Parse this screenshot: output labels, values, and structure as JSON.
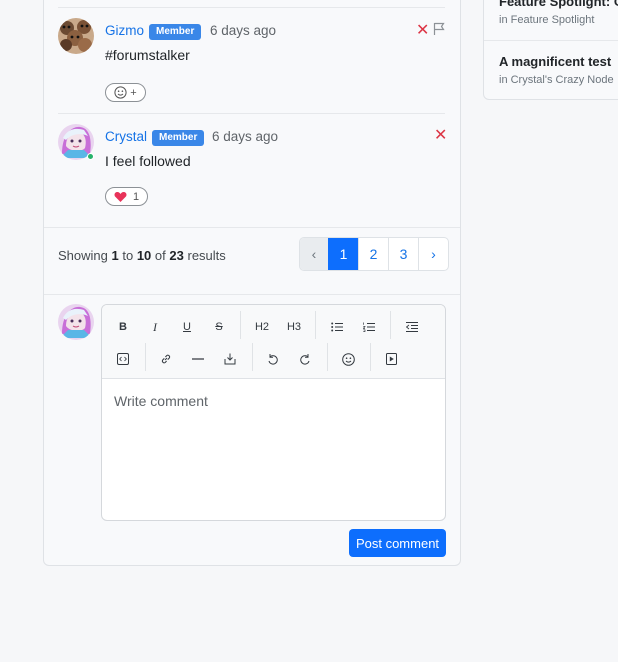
{
  "comments": [
    {
      "user": "Gizmo",
      "role": "Member",
      "time": "6 days ago",
      "text": "#forumstalker",
      "reaction_add_label": "+",
      "avatar": "gizmo-avatar",
      "online": false
    },
    {
      "user": "Crystal",
      "role": "Member",
      "time": "6 days ago",
      "text": "I feel followed",
      "reaction_count": "1",
      "reaction_color": "#e8335a",
      "avatar": "crystal-avatar",
      "online": true
    }
  ],
  "pagination": {
    "showing_prefix": "Showing",
    "from": "1",
    "to_word": "to",
    "to": "10",
    "of_word": "of",
    "total": "23",
    "results_word": "results",
    "prev": "‹",
    "pages": [
      "1",
      "2",
      "3"
    ],
    "active_page": "1",
    "next": "›"
  },
  "editor": {
    "toolbar": [
      "bold-icon",
      "italic-icon",
      "underline-icon",
      "strikethrough-icon",
      "H2",
      "H3",
      "bullet-list-icon",
      "numbered-list-icon",
      "outdent-icon",
      "code-block-icon",
      "link-icon",
      "horizontal-rule-icon",
      "insert-image-icon",
      "undo-icon",
      "redo-icon",
      "emoji-icon",
      "media-icon"
    ],
    "h2": "H2",
    "h3": "H3",
    "placeholder": "Write comment",
    "submit": "Post comment"
  },
  "sidebar": {
    "items": [
      {
        "title": "Feature Spotlight: C",
        "category": "in Feature Spotlight"
      },
      {
        "title": "A magnificent test",
        "category": "in Crystal's Crazy Node"
      }
    ]
  },
  "colors": {
    "accent": "#0d6efd",
    "link": "#1673e6",
    "badge": "#3a87e8",
    "danger": "#dc3545",
    "online": "#27b36b"
  }
}
